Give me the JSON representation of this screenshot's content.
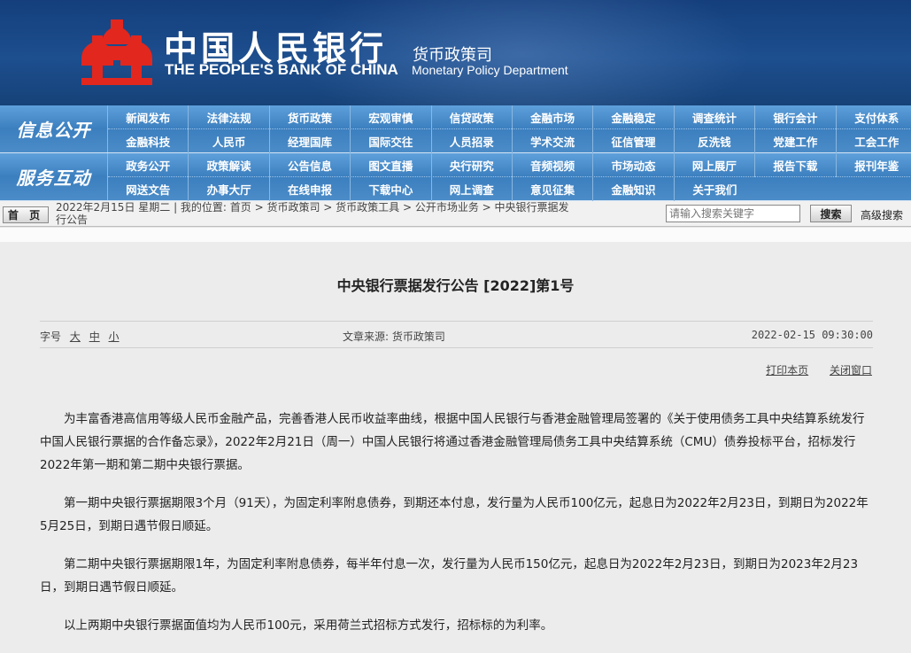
{
  "header": {
    "bank_name_cn": "中国人民银行",
    "bank_name_en": "THE PEOPLE'S BANK OF CHINA",
    "dept_cn": "货币政策司",
    "dept_en": "Monetary Policy Department",
    "logo_icon": "pboc-emblem-icon",
    "colors": {
      "banner": "#1d4e8e",
      "logo_red": "#e2271e",
      "nav": "#4a8ac6"
    }
  },
  "nav": {
    "section1_title": "信息公开",
    "section1_row1": [
      "新闻发布",
      "法律法规",
      "货币政策",
      "宏观审慎",
      "信贷政策",
      "金融市场",
      "金融稳定",
      "调查统计",
      "银行会计",
      "支付体系"
    ],
    "section1_row2": [
      "金融科技",
      "人民币",
      "经理国库",
      "国际交往",
      "人员招录",
      "学术交流",
      "征信管理",
      "反洗钱",
      "党建工作",
      "工会工作"
    ],
    "section2_title": "服务互动",
    "section2_row1": [
      "政务公开",
      "政策解读",
      "公告信息",
      "图文直播",
      "央行研究",
      "音频视频",
      "市场动态",
      "网上展厅",
      "报告下载",
      "报刊年鉴"
    ],
    "section2_row2": [
      "网送文告",
      "办事大厅",
      "在线申报",
      "下载中心",
      "网上调查",
      "意见征集",
      "金融知识",
      "关于我们"
    ]
  },
  "breadcrumb": {
    "home_label": "首 页",
    "date_text": "2022年2月15日  星期二",
    "location_label": "我的位置:",
    "items": [
      "首页",
      "货币政策司",
      "货币政策工具",
      "公开市场业务",
      "中央银行票据发行公告"
    ],
    "line1": "2022年2月15日  星期二  |  我的位置: 首页  >  货币政策司  >  货币政策工具  >  公开市场业务  >  中央银行票据发",
    "line2": "行公告"
  },
  "search": {
    "placeholder": "请输入搜索关键字",
    "button_label": "搜索",
    "advanced_label": "高级搜索"
  },
  "article": {
    "title": "中央银行票据发行公告 [2022]第1号",
    "font_size_label": "字号",
    "font_sizes": [
      "大",
      "中",
      "小"
    ],
    "source": "文章来源: 货币政策司",
    "datetime": "2022-02-15  09:30:00",
    "print_label": "打印本页",
    "close_label": "关闭窗口",
    "paragraphs": [
      "为丰富香港高信用等级人民币金融产品，完善香港人民币收益率曲线，根据中国人民银行与香港金融管理局签署的《关于使用债务工具中央结算系统发行中国人民银行票据的合作备忘录》，2022年2月21日（周一）中国人民银行将通过香港金融管理局债务工具中央结算系统（CMU）债券投标平台，招标发行2022年第一期和第二期中央银行票据。",
      "第一期中央银行票据期限3个月（91天），为固定利率附息债券，到期还本付息，发行量为人民币100亿元，起息日为2022年2月23日，到期日为2022年5月25日，到期日遇节假日顺延。",
      "第二期中央银行票据期限1年，为固定利率附息债券，每半年付息一次，发行量为人民币150亿元，起息日为2022年2月23日，到期日为2023年2月23日，到期日遇节假日顺延。",
      "以上两期中央银行票据面值均为人民币100元，采用荷兰式招标方式发行，招标标的为利率。"
    ]
  }
}
